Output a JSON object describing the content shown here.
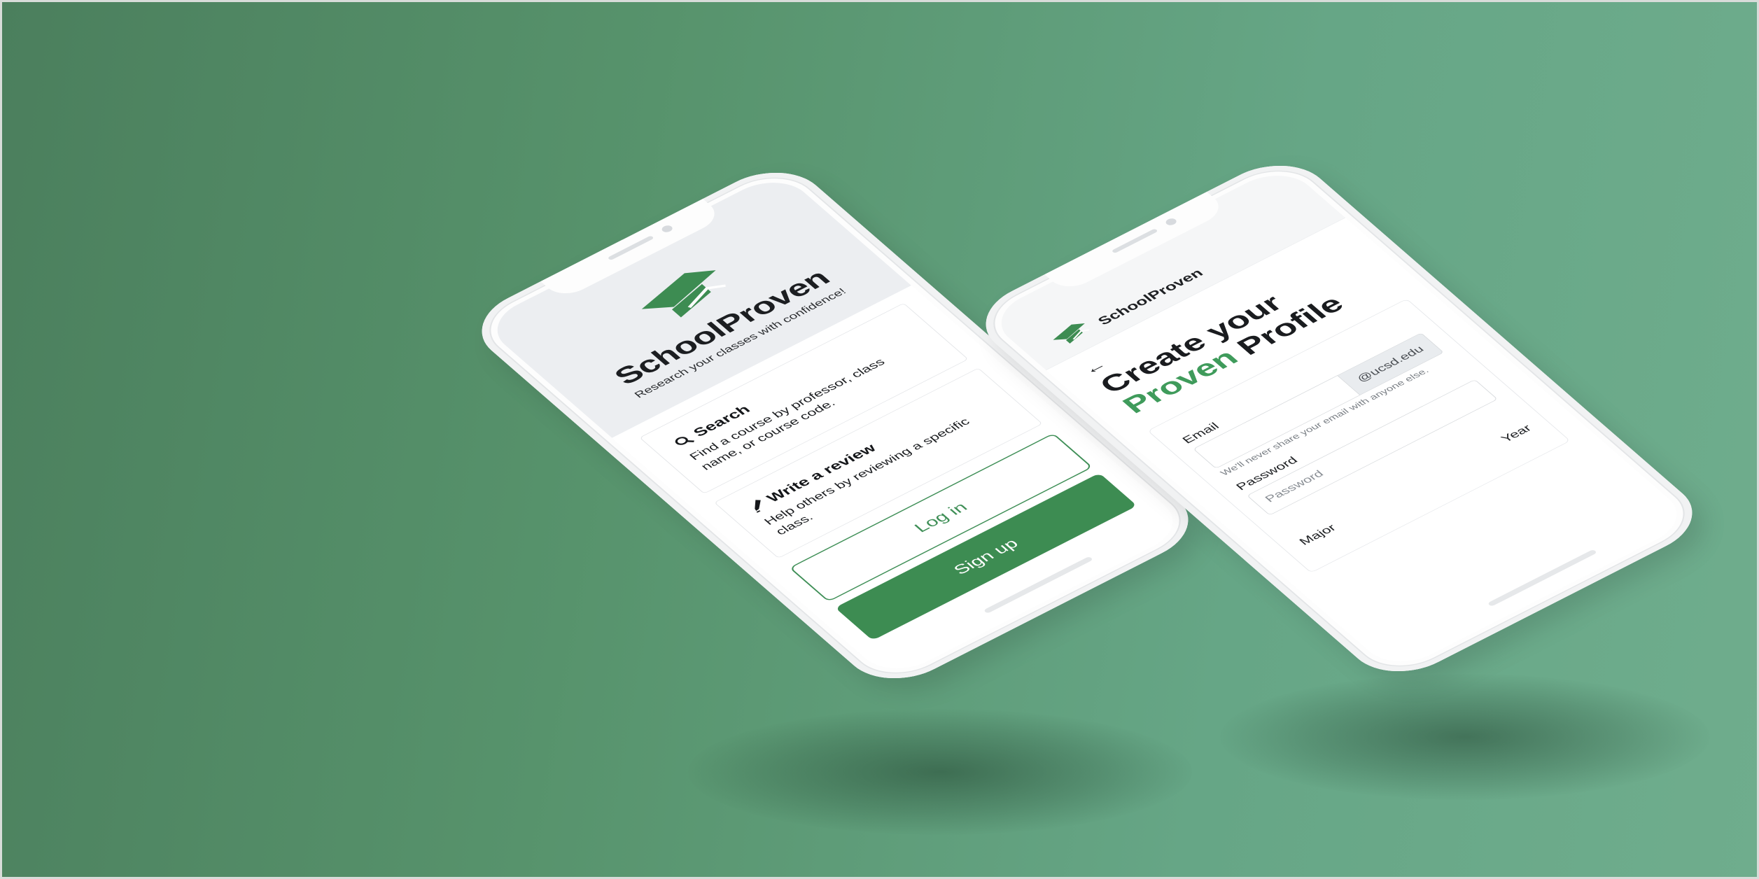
{
  "colors": {
    "brand_green": "#3d8c52",
    "accent_green": "#3f9b5b",
    "hero_bg": "#eceef1",
    "background_green": "#57936c"
  },
  "phone_left": {
    "logo_icon": "graduation-cap-icon",
    "brand": "SchoolProven",
    "tagline": "Research your classes with confidence!",
    "cards": [
      {
        "icon": "search-icon",
        "title": "Search",
        "text": "Find a course by professor, class name, or course code."
      },
      {
        "icon": "pen-icon",
        "title": "Write a review",
        "text": "Help others by reviewing a specific class."
      }
    ],
    "login_label": "Log in",
    "signup_label": "Sign up"
  },
  "phone_right": {
    "logo_icon": "graduation-cap-icon",
    "brand": "SchoolProven",
    "back_icon": "back-arrow-icon",
    "title_line1": "Create your",
    "title_accent": "Proven",
    "title_rest": " Profile",
    "email_label": "Email",
    "email_placeholder": "",
    "email_addon": "@ucsd.edu",
    "email_help": "We'll never share your email with anyone else.",
    "password_label": "Password",
    "password_placeholder": "Password",
    "major_label": "Major",
    "year_label": "Year"
  }
}
